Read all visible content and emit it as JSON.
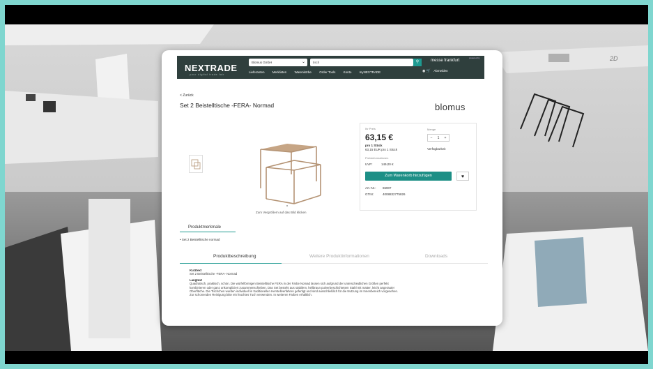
{
  "header": {
    "logo": "NEXTRADE",
    "logo_sub": "your digital trade fair",
    "exhibitor_select": "Blomus GmbH",
    "search_value": "tisch",
    "partner_logo": "messe frankfurt",
    "powered_by": "powered by",
    "nav": [
      "Lieferanten",
      "Merklisten",
      "Warenkörbe",
      "Order Tools",
      "Konto",
      "myNEXTRADE"
    ],
    "logout": "Abmelden"
  },
  "product": {
    "back": "< Zurück",
    "title": "Set 2 Beistelltische -FERA- Normad",
    "brand": "blomus",
    "zoom_hint": "Zum Vergrößern auf das Bild klicken"
  },
  "buybox": {
    "price_label": "Ihr Preis",
    "price": "63,15 €",
    "unit": "pro 1 Stück",
    "unit_price": "63,15 EUR pro 1 Stück",
    "qty_label": "Menge",
    "qty_value": "1",
    "availability": "Verfügbarkeit",
    "retail_label": "Preisinformationen",
    "uvp_label": "UVP:",
    "uvp_value": "149,00 €",
    "cart_button": "Zum Warenkorb hinzufügen",
    "art_label": "Art.-Nr.:",
    "art_value": "65907",
    "gtin_label": "GTIN:",
    "gtin_value": "4008832775826"
  },
  "features": {
    "title": "Produktmerkmale",
    "item": "Set 2 Beistelltische normad"
  },
  "tabs": [
    "Produktbeschreibung",
    "Weitere Produktinformationen",
    "Downloads"
  ],
  "description": {
    "short_heading": "Kurztext",
    "short_text": "Set 2 Beistelltische -FERA- Normad",
    "long_heading": "Langtext",
    "long_text": "Quadratisch, praktisch, schön. Die würfelförmigen Beistelltische FERA in der Farbe Nomad lassen sich aufgrund der unterschiedlichen Größen perfekt kombinieren oder ganz unkompliziert zusammenschieben. Das Set besteht aus stabilem, hellbraun pulverbeschichtetem Stahl mit matter, leicht angerauter Oberfläche. Die Tischchen wurden individuell in traditionellen Herstellverfahren gefertigt und sind ausschließlich für die Nutzung im Innenbereich vorgesehen. Zur schonenden Reinigung bitte ein feuchtes Tuch verwenden. In weiteren Farben erhältlich."
  },
  "colors": {
    "accent": "#1e9a91",
    "header_bg": "#2f3f3d",
    "product_tone": "#b49374"
  },
  "scene": {
    "wall_label": "2D"
  }
}
